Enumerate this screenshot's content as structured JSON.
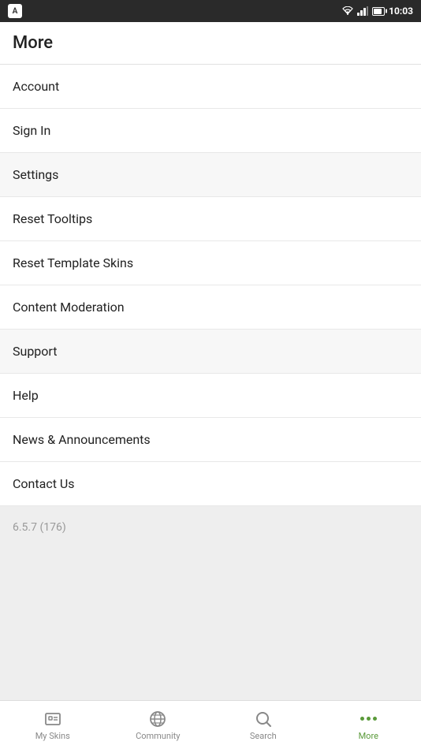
{
  "statusBar": {
    "time": "10:03"
  },
  "header": {
    "title": "More"
  },
  "menuItems": [
    {
      "id": "account",
      "label": "Account"
    },
    {
      "id": "sign-in",
      "label": "Sign In"
    },
    {
      "id": "settings",
      "label": "Settings"
    },
    {
      "id": "reset-tooltips",
      "label": "Reset Tooltips"
    },
    {
      "id": "reset-template-skins",
      "label": "Reset Template Skins"
    },
    {
      "id": "content-moderation",
      "label": "Content Moderation"
    },
    {
      "id": "support",
      "label": "Support"
    },
    {
      "id": "help",
      "label": "Help"
    },
    {
      "id": "news-announcements",
      "label": "News & Announcements"
    },
    {
      "id": "contact-us",
      "label": "Contact Us"
    }
  ],
  "version": {
    "text": "6.5.7 (176)"
  },
  "bottomNav": {
    "items": [
      {
        "id": "my-skins",
        "label": "My Skins",
        "active": false
      },
      {
        "id": "community",
        "label": "Community",
        "active": false
      },
      {
        "id": "search",
        "label": "Search",
        "active": false
      },
      {
        "id": "more",
        "label": "More",
        "active": true
      }
    ]
  }
}
